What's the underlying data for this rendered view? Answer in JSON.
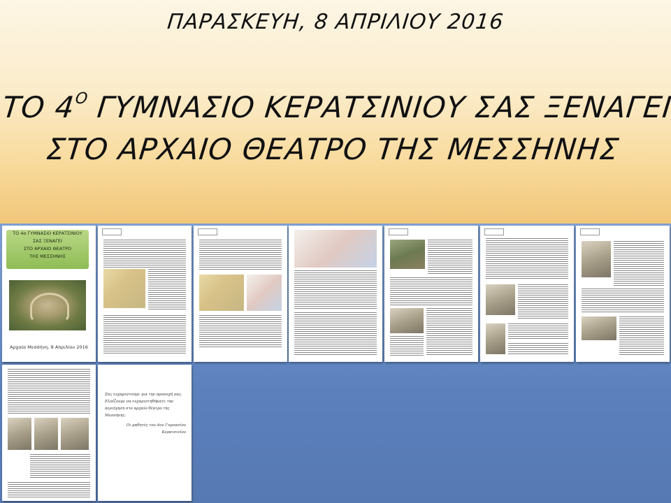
{
  "header": {
    "date": "ΠΑΡΑΣΚΕΥΗ, 8 ΑΠΡΙΛΙΟΥ 2016",
    "title_line1_pre": "ΤΟ 4",
    "title_line1_sup": "Ο",
    "title_line1_post": " ΓΥΜΝΑΣΙΟ ΚΕΡΑΤΣΙΝΙΟΥ ΣΑΣ ΞΕΝΑΓΕΙ",
    "title_line2": "ΣΤΟ ΑΡΧΑΙΟ ΘΕΑΤΡΟ ΤΗΣ ΜΕΣΣΗΝΗΣ"
  },
  "cover": {
    "line1": "ΤΟ 4ο ΓΥΜΝΑΣΙΟ ΚΕΡΑΤΣΙΝΙΟΥ",
    "line2": "ΣΑΣ ΞΕΝΑΓΕΙ",
    "line3": "ΣΤΟ ΑΡΧΑΙΟ ΘΕΑΤΡΟ",
    "line4": "ΤΗΣ ΜΕΣΣΗΝΗΣ",
    "footer": "Αρχαία Μεσσήνη, 8 Απριλίου 2016"
  },
  "closing_quote": {
    "text": "Σας ευχαριστούμε για την προσοχή σας. Ελπίζουμε να ευχαριστηθήκατε την περιήγηση στο αρχαίο θέατρο της Μεσσήνης.",
    "signature": "Οι μαθητές του 4ου Γυμνασίου Κερατσινίου"
  }
}
